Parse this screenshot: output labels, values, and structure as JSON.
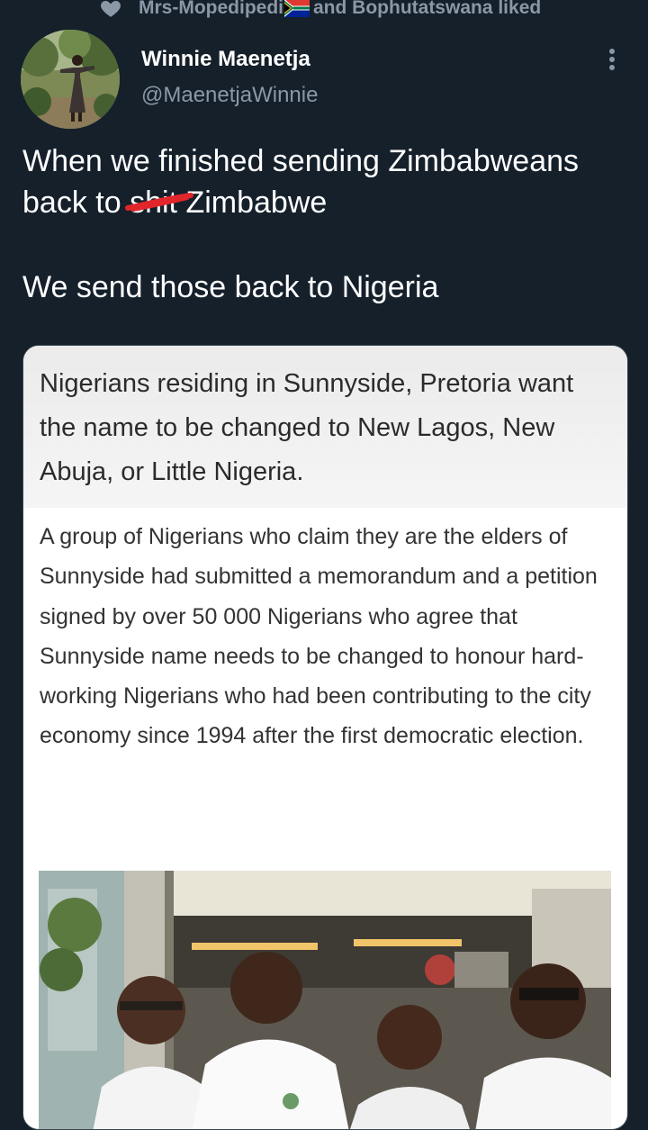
{
  "social_context": {
    "text_before_flag": "Mrs-Mopedipedi",
    "text_after_flag": " and Bophutatswana liked",
    "icon": "heart-icon",
    "flag_icon": "south-africa-flag-emoji"
  },
  "author": {
    "name": "Winnie Maenetja",
    "handle": "@MaenetjaWinnie"
  },
  "tweet": {
    "line1": "When we finished sending Zimbabweans",
    "line2_before": "back to ",
    "line2_censored": "shit",
    "line2_after": " Zimbabwe",
    "line3": "We send those back to Nigeria",
    "censor_color": "#e0262b"
  },
  "media": {
    "headline": "Nigerians residing in Sunnyside, Pretoria want the name to be changed to New Lagos, New Abuja, or Little Nigeria.",
    "body": "A group of Nigerians who claim they are the elders of Sunnyside had submitted a memorandum and a petition signed by over 50 000 Nigerians who agree that Sunnyside name needs to be changed to honour hard-working Nigerians who had been contributing to the city economy since 1994 after the first democratic election."
  },
  "colors": {
    "background": "#15202b",
    "primary_text": "#ffffff",
    "secondary_text": "#8b98a5"
  }
}
